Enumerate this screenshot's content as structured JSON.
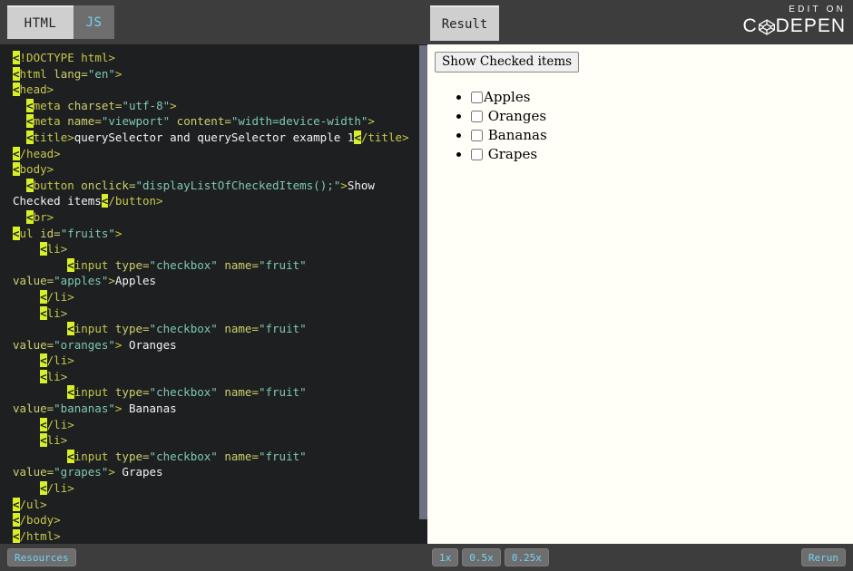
{
  "header": {
    "tabs": [
      {
        "label": "HTML",
        "state": "active"
      },
      {
        "label": "JS",
        "state": "inactive"
      }
    ],
    "result_tab": {
      "label": "Result"
    },
    "brand": {
      "edit_on": "EDIT ON",
      "name_prefix": "C",
      "name_suffix": "DEPEN",
      "logo_icon": "codepen-logo-icon"
    }
  },
  "editor": {
    "language": "HTML",
    "code_lines": [
      {
        "indent": 0,
        "segments": [
          {
            "t": "br",
            "v": "<"
          },
          {
            "t": "tg",
            "v": "!DOCTYPE html>"
          }
        ]
      },
      {
        "indent": 0,
        "segments": [
          {
            "t": "br",
            "v": "<"
          },
          {
            "t": "tg",
            "v": "html "
          },
          {
            "t": "at",
            "v": "lang="
          },
          {
            "t": "st",
            "v": "\"en\""
          },
          {
            "t": "tg",
            "v": ">"
          }
        ]
      },
      {
        "indent": 0,
        "segments": [
          {
            "t": "br",
            "v": "<"
          },
          {
            "t": "tg",
            "v": "head>"
          }
        ]
      },
      {
        "indent": 1,
        "segments": [
          {
            "t": "br",
            "v": "<"
          },
          {
            "t": "tg",
            "v": "meta "
          },
          {
            "t": "at",
            "v": "charset="
          },
          {
            "t": "st",
            "v": "\"utf-8\""
          },
          {
            "t": "tg",
            "v": ">"
          }
        ]
      },
      {
        "indent": 1,
        "segments": [
          {
            "t": "br",
            "v": "<"
          },
          {
            "t": "tg",
            "v": "meta "
          },
          {
            "t": "at",
            "v": "name="
          },
          {
            "t": "st",
            "v": "\"viewport\""
          },
          {
            "t": "at",
            "v": " content="
          },
          {
            "t": "st",
            "v": "\"width=device-width\""
          },
          {
            "t": "tg",
            "v": ">"
          }
        ]
      },
      {
        "indent": 1,
        "segments": [
          {
            "t": "br",
            "v": "<"
          },
          {
            "t": "tg",
            "v": "title>"
          },
          {
            "t": "tx",
            "v": "querySelector and querySelector example 1"
          },
          {
            "t": "br",
            "v": "<"
          },
          {
            "t": "tg",
            "v": "/title>"
          }
        ]
      },
      {
        "indent": 0,
        "segments": [
          {
            "t": "br",
            "v": "<"
          },
          {
            "t": "tg",
            "v": "/head>"
          }
        ]
      },
      {
        "indent": 0,
        "segments": [
          {
            "t": "br",
            "v": "<"
          },
          {
            "t": "tg",
            "v": "body>"
          }
        ]
      },
      {
        "indent": 1,
        "segments": [
          {
            "t": "br",
            "v": "<"
          },
          {
            "t": "tg",
            "v": "button "
          },
          {
            "t": "at",
            "v": "onclick="
          },
          {
            "t": "st",
            "v": "\"displayListOfCheckedItems();\""
          },
          {
            "t": "tg",
            "v": ">"
          },
          {
            "t": "tx",
            "v": "Show Checked items"
          },
          {
            "t": "br",
            "v": "<"
          },
          {
            "t": "tg",
            "v": "/button>"
          }
        ]
      },
      {
        "indent": 1,
        "segments": [
          {
            "t": "br",
            "v": "<"
          },
          {
            "t": "tg",
            "v": "br>"
          }
        ]
      },
      {
        "indent": 0,
        "segments": [
          {
            "t": "br",
            "v": "<"
          },
          {
            "t": "tg",
            "v": "ul "
          },
          {
            "t": "at",
            "v": "id="
          },
          {
            "t": "st",
            "v": "\"fruits\""
          },
          {
            "t": "tg",
            "v": ">"
          }
        ]
      },
      {
        "indent": 2,
        "segments": [
          {
            "t": "br",
            "v": "<"
          },
          {
            "t": "tg",
            "v": "li>"
          }
        ]
      },
      {
        "indent": 4,
        "segments": [
          {
            "t": "br",
            "v": "<"
          },
          {
            "t": "tg",
            "v": "input "
          },
          {
            "t": "at",
            "v": "type="
          },
          {
            "t": "st",
            "v": "\"checkbox\""
          },
          {
            "t": "at",
            "v": " name="
          },
          {
            "t": "st",
            "v": "\"fruit\""
          },
          {
            "t": "at",
            "v": " value="
          },
          {
            "t": "st",
            "v": "\"apples\""
          },
          {
            "t": "tg",
            "v": ">"
          },
          {
            "t": "tx",
            "v": "Apples"
          }
        ]
      },
      {
        "indent": 2,
        "segments": [
          {
            "t": "br",
            "v": "<"
          },
          {
            "t": "tg",
            "v": "/li>"
          }
        ]
      },
      {
        "indent": 2,
        "segments": [
          {
            "t": "br",
            "v": "<"
          },
          {
            "t": "tg",
            "v": "li>"
          }
        ]
      },
      {
        "indent": 4,
        "segments": [
          {
            "t": "br",
            "v": "<"
          },
          {
            "t": "tg",
            "v": "input "
          },
          {
            "t": "at",
            "v": "type="
          },
          {
            "t": "st",
            "v": "\"checkbox\""
          },
          {
            "t": "at",
            "v": " name="
          },
          {
            "t": "st",
            "v": "\"fruit\""
          },
          {
            "t": "at",
            "v": " value="
          },
          {
            "t": "st",
            "v": "\"oranges\""
          },
          {
            "t": "tg",
            "v": ">"
          },
          {
            "t": "tx",
            "v": " Oranges"
          }
        ]
      },
      {
        "indent": 2,
        "segments": [
          {
            "t": "br",
            "v": "<"
          },
          {
            "t": "tg",
            "v": "/li>"
          }
        ]
      },
      {
        "indent": 2,
        "segments": [
          {
            "t": "br",
            "v": "<"
          },
          {
            "t": "tg",
            "v": "li>"
          }
        ]
      },
      {
        "indent": 4,
        "segments": [
          {
            "t": "br",
            "v": "<"
          },
          {
            "t": "tg",
            "v": "input "
          },
          {
            "t": "at",
            "v": "type="
          },
          {
            "t": "st",
            "v": "\"checkbox\""
          },
          {
            "t": "at",
            "v": " name="
          },
          {
            "t": "st",
            "v": "\"fruit\""
          },
          {
            "t": "at",
            "v": " value="
          },
          {
            "t": "st",
            "v": "\"bananas\""
          },
          {
            "t": "tg",
            "v": ">"
          },
          {
            "t": "tx",
            "v": " Bananas"
          }
        ]
      },
      {
        "indent": 2,
        "segments": [
          {
            "t": "br",
            "v": "<"
          },
          {
            "t": "tg",
            "v": "/li>"
          }
        ]
      },
      {
        "indent": 2,
        "segments": [
          {
            "t": "br",
            "v": "<"
          },
          {
            "t": "tg",
            "v": "li>"
          }
        ]
      },
      {
        "indent": 4,
        "segments": [
          {
            "t": "br",
            "v": "<"
          },
          {
            "t": "tg",
            "v": "input "
          },
          {
            "t": "at",
            "v": "type="
          },
          {
            "t": "st",
            "v": "\"checkbox\""
          },
          {
            "t": "at",
            "v": " name="
          },
          {
            "t": "st",
            "v": "\"fruit\""
          },
          {
            "t": "at",
            "v": " value="
          },
          {
            "t": "st",
            "v": "\"grapes\""
          },
          {
            "t": "tg",
            "v": ">"
          },
          {
            "t": "tx",
            "v": " Grapes"
          }
        ]
      },
      {
        "indent": 2,
        "segments": [
          {
            "t": "br",
            "v": "<"
          },
          {
            "t": "tg",
            "v": "/li>"
          }
        ]
      },
      {
        "indent": 0,
        "segments": [
          {
            "t": "br",
            "v": "<"
          },
          {
            "t": "tg",
            "v": "/ul>"
          }
        ]
      },
      {
        "indent": 0,
        "segments": [
          {
            "t": "br",
            "v": "<"
          },
          {
            "t": "tg",
            "v": "/body>"
          }
        ]
      },
      {
        "indent": 0,
        "segments": [
          {
            "t": "br",
            "v": "<"
          },
          {
            "t": "tg",
            "v": "/html>"
          }
        ]
      }
    ]
  },
  "result": {
    "button_label": "Show Checked items",
    "items": [
      {
        "label": "Apples",
        "checked": false,
        "value": "apples"
      },
      {
        "label": "Oranges",
        "checked": false,
        "value": "oranges"
      },
      {
        "label": "Bananas",
        "checked": false,
        "value": "bananas"
      },
      {
        "label": "Grapes",
        "checked": false,
        "value": "grapes"
      }
    ]
  },
  "footer": {
    "resources_label": "Resources",
    "zoom_levels": [
      {
        "label": "1x",
        "selected": true
      },
      {
        "label": "0.5x",
        "selected": false
      },
      {
        "label": "0.25x",
        "selected": false
      }
    ],
    "rerun_label": "Rerun"
  },
  "colors": {
    "chrome_bg": "#3d3d3d",
    "editor_bg": "#1d1f21",
    "accent_cyan": "#6fd6f5",
    "bracket_highlight": "#d8f028",
    "tag_olive": "#c7c74b",
    "string_teal": "#7fc9b0",
    "result_bg": "#fffff8",
    "scrollbar_thumb": "#6c7080"
  }
}
